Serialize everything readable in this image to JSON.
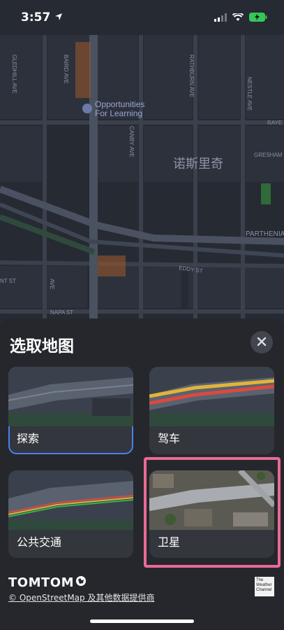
{
  "status_bar": {
    "time": "3:57",
    "location_icon": "location-arrow-icon",
    "signal_icon": "cellular-signal-icon",
    "wifi_icon": "wifi-icon",
    "battery_icon": "battery-charging-icon"
  },
  "map": {
    "poi_name_line1": "Opportunities",
    "poi_name_line2": "For Learning",
    "area_label": "诺斯里奇",
    "streets": {
      "gledhill": "GLEDHILL AVE",
      "bairdg": "BAIRD AVE",
      "canby": "CANBY AVE",
      "rathburn": "RATHBURN AVE",
      "nestle": "NESTLE AVE",
      "raye": "RAYE",
      "gresham": "GRESHAM",
      "parthenia": "PARTHENIA",
      "eddy": "EDDY ST",
      "nt": "NT ST",
      "napa": "NAPA ST",
      "avenue_fragment": "AVE"
    },
    "colors": {
      "road": "#3a404c",
      "highway": "#4a5160",
      "block": "#262a33",
      "orange": "#a15a2a",
      "green": "#2f4a3c"
    }
  },
  "sheet": {
    "title": "选取地图",
    "close_icon": "close-icon",
    "cards": [
      {
        "label": "探索",
        "selected": true
      },
      {
        "label": "驾车",
        "selected": false
      },
      {
        "label": "公共交通",
        "selected": false
      },
      {
        "label": "卫星",
        "selected": false
      }
    ],
    "tomtom_text": "TOMTOM",
    "attribution": "© OpenStreetMap 及其他数据提供商",
    "weather_logo_line1": "The",
    "weather_logo_line2": "Weather",
    "weather_logo_line3": "Channel",
    "colors": {
      "selected_border": "#4a80f0",
      "highlight": "#ea6a93"
    }
  }
}
